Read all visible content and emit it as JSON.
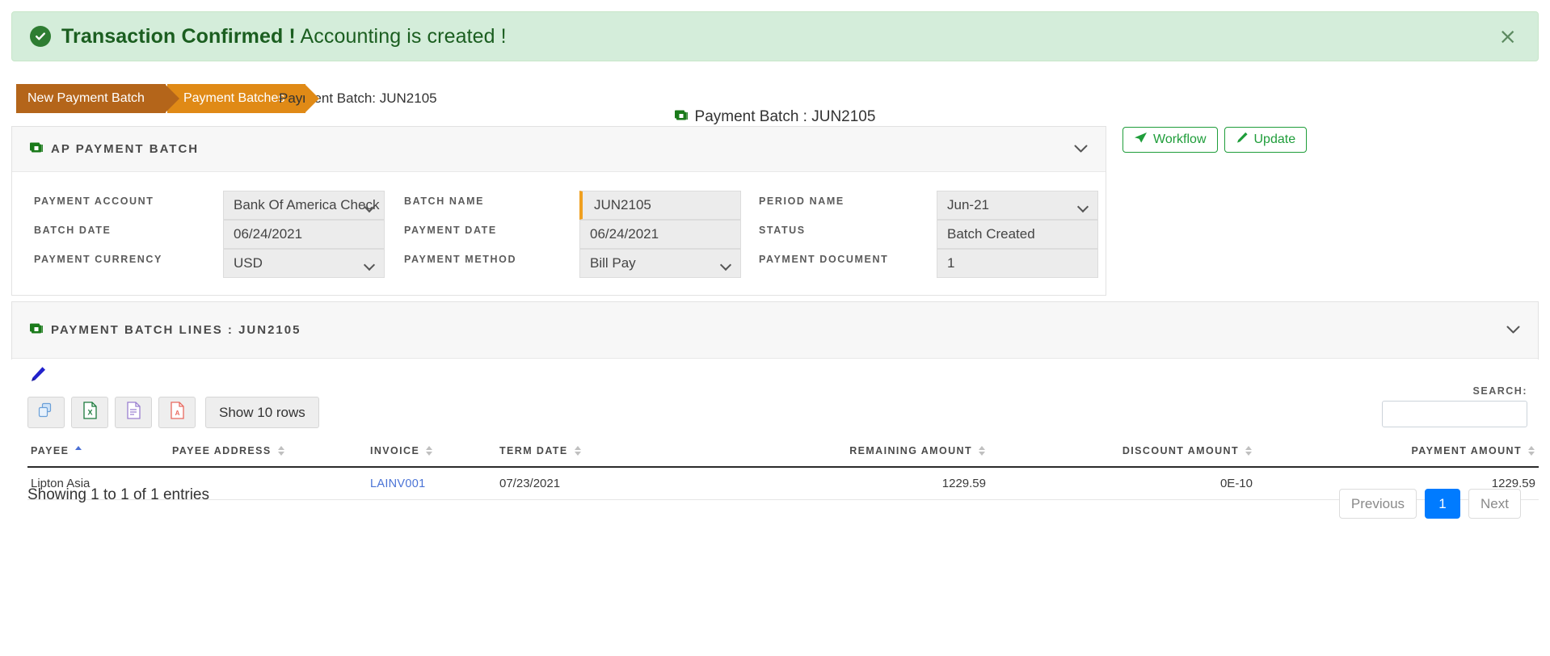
{
  "alert": {
    "icon": "check-circle-icon",
    "strong": "Transaction Confirmed !",
    "rest": " Accounting is created !",
    "close_label": "×",
    "bg_color": "#d4edda",
    "text_color": "#1b5e20"
  },
  "breadcrumb": {
    "items": [
      {
        "label": "New Payment Batch",
        "color": "#b4651a"
      },
      {
        "label": "Payment Batches",
        "color": "#e08a16"
      }
    ],
    "current": "Payment Batch: JUN2105"
  },
  "page_title": "Payment Batch : JUN2105",
  "panels": {
    "ap_payment_batch": {
      "title": "AP PAYMENT BATCH",
      "collapse_icon": "chevron-down-icon"
    },
    "payment_batch_lines": {
      "title": "PAYMENT BATCH LINES : JUN2105",
      "collapse_icon": "chevron-down-icon"
    }
  },
  "actions": {
    "workflow_label": "Workflow",
    "workflow_icon": "paper-plane-icon",
    "update_label": "Update",
    "update_icon": "pencil-icon",
    "accent_color": "#1f9d3a"
  },
  "form": {
    "payment_account": {
      "label": "PAYMENT ACCOUNT",
      "value": "Bank Of America Check",
      "type": "select"
    },
    "batch_date": {
      "label": "BATCH DATE",
      "value": "06/24/2021",
      "type": "text"
    },
    "payment_currency": {
      "label": "PAYMENT CURRENCY",
      "value": "USD",
      "type": "select"
    },
    "batch_name": {
      "label": "BATCH NAME",
      "value": "JUN2105",
      "type": "text",
      "required_marker_color": "#f0a020"
    },
    "payment_date": {
      "label": "PAYMENT DATE",
      "value": "06/24/2021",
      "type": "text"
    },
    "payment_method": {
      "label": "PAYMENT METHOD",
      "value": "Bill Pay",
      "type": "select"
    },
    "period_name": {
      "label": "PERIOD NAME",
      "value": "Jun-21",
      "type": "select"
    },
    "status": {
      "label": "STATUS",
      "value": "Batch Created",
      "type": "text"
    },
    "payment_document": {
      "label": "PAYMENT DOCUMENT",
      "value": "1",
      "type": "text"
    }
  },
  "lines_toolbar": {
    "edit_icon": "pencil-icon",
    "buttons": [
      {
        "name": "copy-button",
        "icon": "copy-icon"
      },
      {
        "name": "excel-button",
        "icon": "excel-icon"
      },
      {
        "name": "csv-button",
        "icon": "document-icon"
      },
      {
        "name": "pdf-button",
        "icon": "pdf-icon"
      }
    ],
    "show_rows_label": "Show 10 rows"
  },
  "search": {
    "label": "SEARCH:",
    "value": "",
    "placeholder": ""
  },
  "table": {
    "columns": [
      {
        "label": "PAYEE",
        "align": "left",
        "sort": "asc"
      },
      {
        "label": "PAYEE ADDRESS",
        "align": "left",
        "sort": "none"
      },
      {
        "label": "INVOICE",
        "align": "left",
        "sort": "none"
      },
      {
        "label": "TERM DATE",
        "align": "left",
        "sort": "none"
      },
      {
        "label": "REMAINING AMOUNT",
        "align": "right",
        "sort": "none"
      },
      {
        "label": "DISCOUNT AMOUNT",
        "align": "right",
        "sort": "none"
      },
      {
        "label": "PAYMENT AMOUNT",
        "align": "right",
        "sort": "none"
      }
    ],
    "rows": [
      {
        "payee": "Lipton Asia",
        "payee_address": "",
        "invoice": "LAINV001",
        "term_date": "07/23/2021",
        "remaining_amount": "1229.59",
        "discount_amount": "0E-10",
        "payment_amount": "1229.59"
      }
    ]
  },
  "footer": {
    "showing": "Showing 1 to 1 of 1 entries",
    "previous": "Previous",
    "page": "1",
    "next": "Next",
    "active_color": "#007bff"
  }
}
